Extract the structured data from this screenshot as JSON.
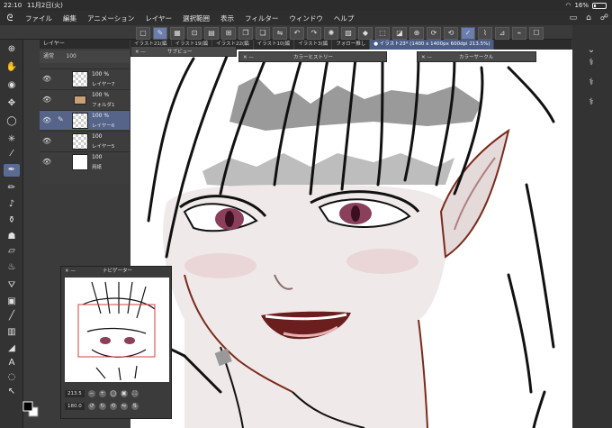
{
  "status": {
    "time": "22:10",
    "date": "11月2日(火)",
    "battery": "16%",
    "battery_level": 0.16
  },
  "menu": {
    "items": [
      "ファイル",
      "編集",
      "アニメーション",
      "レイヤー",
      "選択範囲",
      "表示",
      "フィルター",
      "ウィンドウ",
      "ヘルプ"
    ]
  },
  "tabs": [
    {
      "label": "イラスト21(編"
    },
    {
      "label": "イラスト19(編"
    },
    {
      "label": "イラスト22(編"
    },
    {
      "label": "イラスト10(編"
    },
    {
      "label": "イラスト3(編"
    },
    {
      "label": "フォロー推し"
    },
    {
      "label": "● イラスト23* (1400 x 1400px 600dpi 213.5%)"
    }
  ],
  "floating_panels": {
    "subview": "サブビュー",
    "color_history": "カラーヒストリー",
    "color_circle": "カラーサークル"
  },
  "layer_panel": {
    "header": "レイヤー",
    "blend": "通常",
    "opacity": "100",
    "layers": [
      {
        "opacity": "100 %",
        "name": "レイヤー7"
      },
      {
        "opacity": "100 %",
        "name": "フォルダ1"
      },
      {
        "opacity": "100 %",
        "name": "レイヤー6"
      },
      {
        "opacity": "100",
        "name": "レイヤー5"
      },
      {
        "opacity": "100",
        "name": "用紙"
      }
    ]
  },
  "navigator": {
    "title": "ナビゲーター",
    "zoom": "213.5",
    "rotation": "180.0"
  },
  "colors": {
    "accent": "#5a6b94",
    "tab_active": "#4c5d86",
    "background": "#3b3b3b"
  }
}
